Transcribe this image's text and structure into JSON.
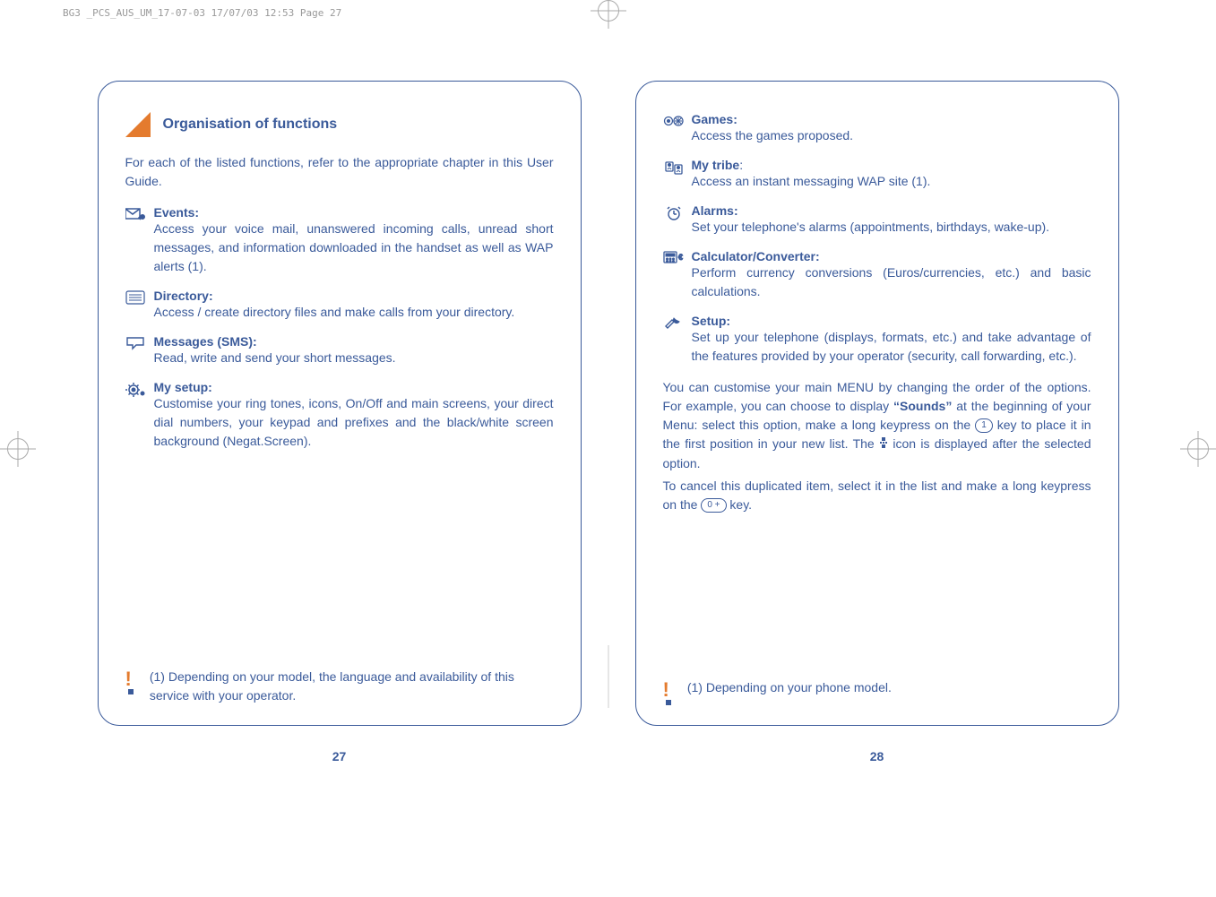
{
  "header": "BG3 _PCS_AUS_UM_17-07-03  17/07/03  12:53  Page 27",
  "left": {
    "heading": "Organisation of functions",
    "intro": "For each of the listed functions, refer to the appropriate chapter in this User Guide.",
    "items": [
      {
        "title": "Events:",
        "desc": "Access your voice mail, unanswered incoming calls, unread short messages, and information downloaded in the handset as well as WAP alerts (1)."
      },
      {
        "title": "Directory:",
        "desc": "Access / create directory files and make calls from your directory."
      },
      {
        "title": "Messages (SMS):",
        "desc": "Read, write and send your short messages."
      },
      {
        "title": "My setup:",
        "desc": "Customise your ring tones, icons, On/Off and main screens, your direct dial numbers, your keypad and prefixes and the black/white screen background (Negat.Screen)."
      }
    ],
    "footnote": "(1)  Depending on your model, the language and availability of this service with your operator.",
    "pagenum": "27"
  },
  "right": {
    "items": [
      {
        "title": "Games:",
        "desc": "Access the games proposed."
      },
      {
        "title_prefix": "My tribe",
        "title_suffix": ":",
        "desc": "Access an instant messaging WAP site (1)."
      },
      {
        "title": "Alarms:",
        "desc": "Set your telephone's alarms (appointments, birthdays, wake-up)."
      },
      {
        "title": "Calculator/Converter:",
        "desc": "Perform currency conversions (Euros/currencies, etc.) and basic calculations."
      },
      {
        "title": "Setup:",
        "desc": "Set up your telephone (displays, formats, etc.) and take advantage of the features provided by your operator (security, call forwarding, etc.)."
      }
    ],
    "para1a": "You can customise your main MENU by changing the order of the options. For example, you can choose to display ",
    "para1_bold": "“Sounds”",
    "para1b": " at the beginning of your Menu: select this option, make a long keypress on the ",
    "para1c": " key to place it in the first position in your new list. The ",
    "para1d": " icon is displayed after the selected option.",
    "para2a": "To cancel this duplicated item, select it in the list and make a long keypress on the ",
    "para2b": " key.",
    "key1": "1",
    "key0": "0 +",
    "footnote": "(1)  Depending on your phone model.",
    "pagenum": "28"
  }
}
